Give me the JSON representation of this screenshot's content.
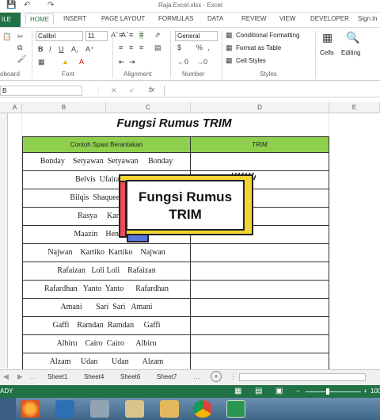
{
  "window": {
    "title": "Raja Excel.xlsx - Excel"
  },
  "ribbon": {
    "tabs": [
      "ILE",
      "HOME",
      "INSERT",
      "PAGE LAYOUT",
      "FORMULAS",
      "DATA",
      "REVIEW",
      "VIEW",
      "DEVELOPER",
      "Sign in"
    ],
    "font_name": "Calibri",
    "font_size": "11",
    "number_format": "General",
    "conditional_formatting": "Conditional Formatting",
    "format_as_table": "Format as Table",
    "cell_styles": "Cell Styles",
    "cells_label": "Cells",
    "editing_label": "Editing",
    "groups": [
      "oboard",
      "Font",
      "Alignment",
      "Number",
      "Styles"
    ]
  },
  "formula_bar": {
    "name_box": "B",
    "fx": "fx"
  },
  "columns": [
    "A",
    "B",
    "C",
    "D",
    "E"
  ],
  "sheet": {
    "title": "Fungsi Rumus TRIM",
    "headers": [
      "Contoh Spasi Berantakan",
      "TRIM"
    ],
    "rows": [
      "Bonday    Setyawan  Setyawan     Bonday",
      "Belvis  Ufaira  Ufai",
      "Bilqis  Shaqueena  Sha",
      "Rasya     Kane   K",
      "Maazin    Hendro  H",
      "Najwan    Kartiko  Kartiko    Najwan",
      "Rafaizan   Loli Loli    Rafaizan",
      "Rafardhan   Yanto  Yanto      Rafardhan",
      "Amani       Sari  Sari   Amani",
      "Gaffi    Ramdan  Ramdan     Gaffi",
      "Albiru    Cairo  Cairo      Albiru",
      "Alzam     Udan       Udan       Alzam"
    ]
  },
  "overlay": {
    "line1": "Fungsi Rumus",
    "line2": "TRIM"
  },
  "sheet_tabs": [
    "Sheet1",
    "Sheet4",
    "Sheet6",
    "Sheet7"
  ],
  "status": {
    "mode": "ADY",
    "zoom": "100"
  },
  "colors": {
    "excel_green": "#217346",
    "header_fill": "#8fcf4e",
    "overlay_yellow": "#f2d532"
  }
}
